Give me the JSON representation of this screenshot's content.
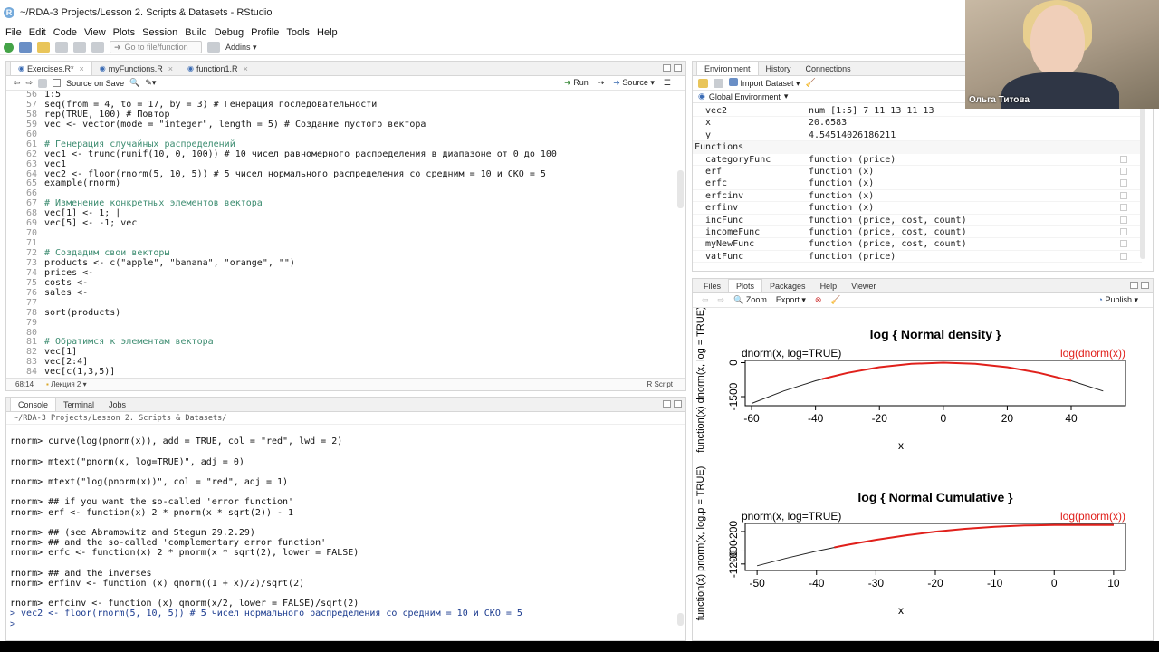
{
  "window": {
    "title": "~/RDA-3 Projects/Lesson 2. Scripts & Datasets - RStudio"
  },
  "menu": [
    "File",
    "Edit",
    "Code",
    "View",
    "Plots",
    "Session",
    "Build",
    "Debug",
    "Profile",
    "Tools",
    "Help"
  ],
  "toolbar": {
    "goto_placeholder": "Go to file/function",
    "addins": "Addins"
  },
  "editor": {
    "tabs": [
      "Exercises.R*",
      "myFunctions.R",
      "function1.R"
    ],
    "source_on_save": "Source on Save",
    "run": "Run",
    "source": "Source",
    "lines": [
      {
        "n": "56",
        "t": "1:5",
        "c": false
      },
      {
        "n": "57",
        "t": "seq(from = 4, to = 17, by = 3) # Генерация последовательности",
        "c": false
      },
      {
        "n": "58",
        "t": "rep(TRUE, 100) # Повтор",
        "c": false
      },
      {
        "n": "59",
        "t": "vec <- vector(mode = \"integer\", length = 5) # Создание пустого вектора",
        "c": false
      },
      {
        "n": "60",
        "t": "",
        "c": false
      },
      {
        "n": "61",
        "t": "# Генерация случайных распределений",
        "c": true
      },
      {
        "n": "62",
        "t": "vec1 <- trunc(runif(10, 0, 100)) # 10 чисел равномерного распределения в диапазоне от 0 до 100",
        "c": false
      },
      {
        "n": "63",
        "t": "vec1",
        "c": false
      },
      {
        "n": "64",
        "t": "vec2 <- floor(rnorm(5, 10, 5)) # 5 чисел нормального распределения со средним = 10 и СКО = 5",
        "c": false
      },
      {
        "n": "65",
        "t": "example(rnorm)",
        "c": false
      },
      {
        "n": "66",
        "t": "",
        "c": false
      },
      {
        "n": "67",
        "t": "# Изменение конкретных элементов вектора",
        "c": true
      },
      {
        "n": "68",
        "t": "vec[1] <- 1; |",
        "c": false
      },
      {
        "n": "69",
        "t": "vec[5] <- -1; vec",
        "c": false
      },
      {
        "n": "70",
        "t": "",
        "c": false
      },
      {
        "n": "71",
        "t": "",
        "c": false
      },
      {
        "n": "72",
        "t": "# Создадим свои векторы",
        "c": true
      },
      {
        "n": "73",
        "t": "products <- c(\"apple\", \"banana\", \"orange\", \"\")",
        "c": false
      },
      {
        "n": "74",
        "t": "prices <-",
        "c": false
      },
      {
        "n": "75",
        "t": "costs <-",
        "c": false
      },
      {
        "n": "76",
        "t": "sales <-",
        "c": false
      },
      {
        "n": "77",
        "t": "",
        "c": false
      },
      {
        "n": "78",
        "t": "sort(products)",
        "c": false
      },
      {
        "n": "79",
        "t": "",
        "c": false
      },
      {
        "n": "80",
        "t": "",
        "c": false
      },
      {
        "n": "81",
        "t": "# Обратимся к элементам вектора",
        "c": true
      },
      {
        "n": "82",
        "t": "vec[1]",
        "c": false
      },
      {
        "n": "83",
        "t": "vec[2:4]",
        "c": false
      },
      {
        "n": "84",
        "t": "vec[c(1,3,5)]",
        "c": false
      }
    ],
    "status": {
      "position": "68:14",
      "section": "Лекция 2",
      "filetype": "R Script"
    }
  },
  "console": {
    "tabs": [
      "Console",
      "Terminal",
      "Jobs"
    ],
    "path": "~/RDA-3 Projects/Lesson 2. Scripts & Datasets/",
    "lines": [
      {
        "t": "",
        "i": false
      },
      {
        "t": "rnorm> curve(log(pnorm(x)), add = TRUE, col = \"red\", lwd = 2)",
        "i": false
      },
      {
        "t": "",
        "i": false
      },
      {
        "t": "rnorm> mtext(\"pnorm(x, log=TRUE)\", adj = 0)",
        "i": false
      },
      {
        "t": "",
        "i": false
      },
      {
        "t": "rnorm> mtext(\"log(pnorm(x))\", col = \"red\", adj = 1)",
        "i": false
      },
      {
        "t": "",
        "i": false
      },
      {
        "t": "rnorm> ## if you want the so-called 'error function'",
        "i": false
      },
      {
        "t": "rnorm> erf <- function(x) 2 * pnorm(x * sqrt(2)) - 1",
        "i": false
      },
      {
        "t": "",
        "i": false
      },
      {
        "t": "rnorm> ## (see Abramowitz and Stegun 29.2.29)",
        "i": false
      },
      {
        "t": "rnorm> ## and the so-called 'complementary error function'",
        "i": false
      },
      {
        "t": "rnorm> erfc <- function(x) 2 * pnorm(x * sqrt(2), lower = FALSE)",
        "i": false
      },
      {
        "t": "",
        "i": false
      },
      {
        "t": "rnorm> ## and the inverses",
        "i": false
      },
      {
        "t": "rnorm> erfinv <- function (x) qnorm((1 + x)/2)/sqrt(2)",
        "i": false
      },
      {
        "t": "",
        "i": false
      },
      {
        "t": "rnorm> erfcinv <- function (x) qnorm(x/2, lower = FALSE)/sqrt(2)",
        "i": false
      },
      {
        "t": "> vec2 <- floor(rnorm(5, 10, 5)) # 5 чисел нормального распределения со средним = 10 и СКО = 5",
        "i": true
      },
      {
        "t": "> ",
        "i": true
      }
    ]
  },
  "environment": {
    "tabs": [
      "Environment",
      "History",
      "Connections"
    ],
    "import": "Import Dataset",
    "scope": "Global Environment",
    "rows_top": [
      {
        "n": "vec2",
        "v": "num [1:5] 7 11 13 11 13"
      },
      {
        "n": "x",
        "v": "20.6583"
      },
      {
        "n": "y",
        "v": "4.54514026186211"
      }
    ],
    "section": "Functions",
    "functions": [
      {
        "n": "categoryFunc",
        "v": "function (price)"
      },
      {
        "n": "erf",
        "v": "function (x)"
      },
      {
        "n": "erfc",
        "v": "function (x)"
      },
      {
        "n": "erfcinv",
        "v": "function (x)"
      },
      {
        "n": "erfinv",
        "v": "function (x)"
      },
      {
        "n": "incFunc",
        "v": "function (price, cost, count)"
      },
      {
        "n": "incomeFunc",
        "v": "function (price, cost, count)"
      },
      {
        "n": "myNewFunc",
        "v": "function (price, cost, count)"
      },
      {
        "n": "vatFunc",
        "v": "function (price)"
      }
    ]
  },
  "plots": {
    "tabs": [
      "Files",
      "Plots",
      "Packages",
      "Help",
      "Viewer"
    ],
    "zoom": "Zoom",
    "export": "Export",
    "publish": "Publish",
    "colors": {
      "black_curve": "#222222",
      "red_curve": "#e0201b"
    }
  },
  "chart_data": [
    {
      "type": "line",
      "title": "log { Normal density }",
      "xlabel": "x",
      "ylabel": "function(x) dnorm(x, log = TRUE)",
      "mtext_left": "dnorm(x, log=TRUE)",
      "mtext_right": "log(dnorm(x))",
      "xlim": [
        -62,
        57
      ],
      "ylim": [
        -1900,
        100
      ],
      "xticks": [
        -60,
        -40,
        -20,
        0,
        20,
        40
      ],
      "yticks": [
        0,
        -1500
      ],
      "series": [
        {
          "x": [
            -60,
            -50,
            -40,
            -30,
            -20,
            -10,
            0,
            10,
            20,
            30,
            40,
            50
          ],
          "y": [
            -1801,
            -1251,
            -801,
            -451,
            -201,
            -51,
            -1,
            -51,
            -201,
            -451,
            -801,
            -1251
          ]
        },
        {
          "x": [
            -38,
            -30,
            -20,
            -10,
            0,
            10,
            20,
            30,
            40
          ],
          "y": [
            -723,
            -451,
            -201,
            -51,
            -1,
            -51,
            -201,
            -451,
            -801
          ]
        }
      ]
    },
    {
      "type": "line",
      "title": "log { Normal Cumulative }",
      "xlabel": "x",
      "ylabel": "function(x) pnorm(x, log.p = TRUE)",
      "mtext_left": "pnorm(x, log=TRUE)",
      "mtext_right": "log(pnorm(x))",
      "xlim": [
        -52,
        12
      ],
      "ylim": [
        -1400,
        50
      ],
      "xticks": [
        -50,
        -40,
        -30,
        -20,
        -10,
        0,
        10
      ],
      "yticks": [
        -200,
        -800,
        -1200
      ],
      "series": [
        {
          "x": [
            -50,
            -45,
            -40,
            -35,
            -30,
            -25,
            -20,
            -15,
            -10,
            -5,
            0,
            5,
            10
          ],
          "y": [
            -1254,
            -1017,
            -804,
            -617,
            -454,
            -317,
            -204,
            -117,
            -53,
            -15,
            -1,
            0,
            0
          ]
        },
        {
          "x": [
            -37,
            -35,
            -30,
            -25,
            -20,
            -15,
            -10,
            -5,
            0,
            5,
            10
          ],
          "y": [
            -689,
            -617,
            -454,
            -317,
            -204,
            -117,
            -53,
            -15,
            -1,
            0,
            0
          ]
        }
      ]
    }
  ],
  "webcam": {
    "name": "Ольга Титова"
  }
}
